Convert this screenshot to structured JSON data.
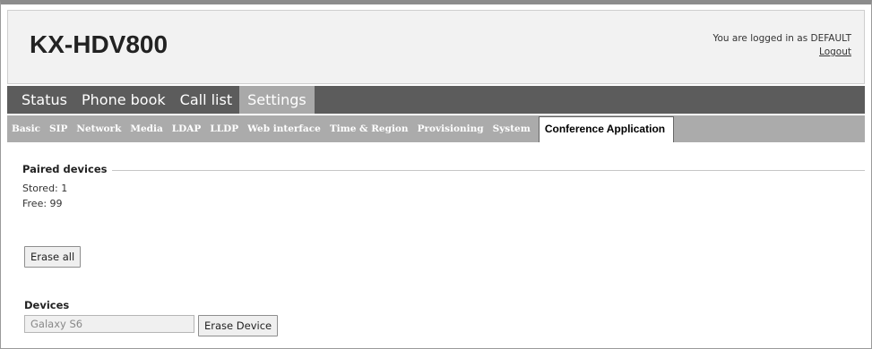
{
  "header": {
    "title": "KX-HDV800",
    "logged_in_text": "You are logged in as DEFAULT",
    "logout_label": "Logout"
  },
  "main_nav": {
    "tabs": [
      {
        "label": "Status",
        "active": false
      },
      {
        "label": "Phone book",
        "active": false
      },
      {
        "label": "Call list",
        "active": false
      },
      {
        "label": "Settings",
        "active": true
      }
    ]
  },
  "sub_nav": {
    "tabs": [
      {
        "label": "Basic",
        "active": false
      },
      {
        "label": "SIP",
        "active": false
      },
      {
        "label": "Network",
        "active": false
      },
      {
        "label": "Media",
        "active": false
      },
      {
        "label": "LDAP",
        "active": false
      },
      {
        "label": "LLDP",
        "active": false
      },
      {
        "label": "Web interface",
        "active": false
      },
      {
        "label": "Time & Region",
        "active": false
      },
      {
        "label": "Provisioning",
        "active": false
      },
      {
        "label": "System",
        "active": false
      },
      {
        "label": "Conference Application",
        "active": true
      }
    ]
  },
  "paired_devices": {
    "legend": "Paired devices",
    "stored": "Stored: 1",
    "free": "Free: 99",
    "erase_all_label": "Erase all"
  },
  "devices": {
    "title": "Devices",
    "selected_device": "Galaxy S6",
    "erase_device_label": "Erase Device"
  }
}
